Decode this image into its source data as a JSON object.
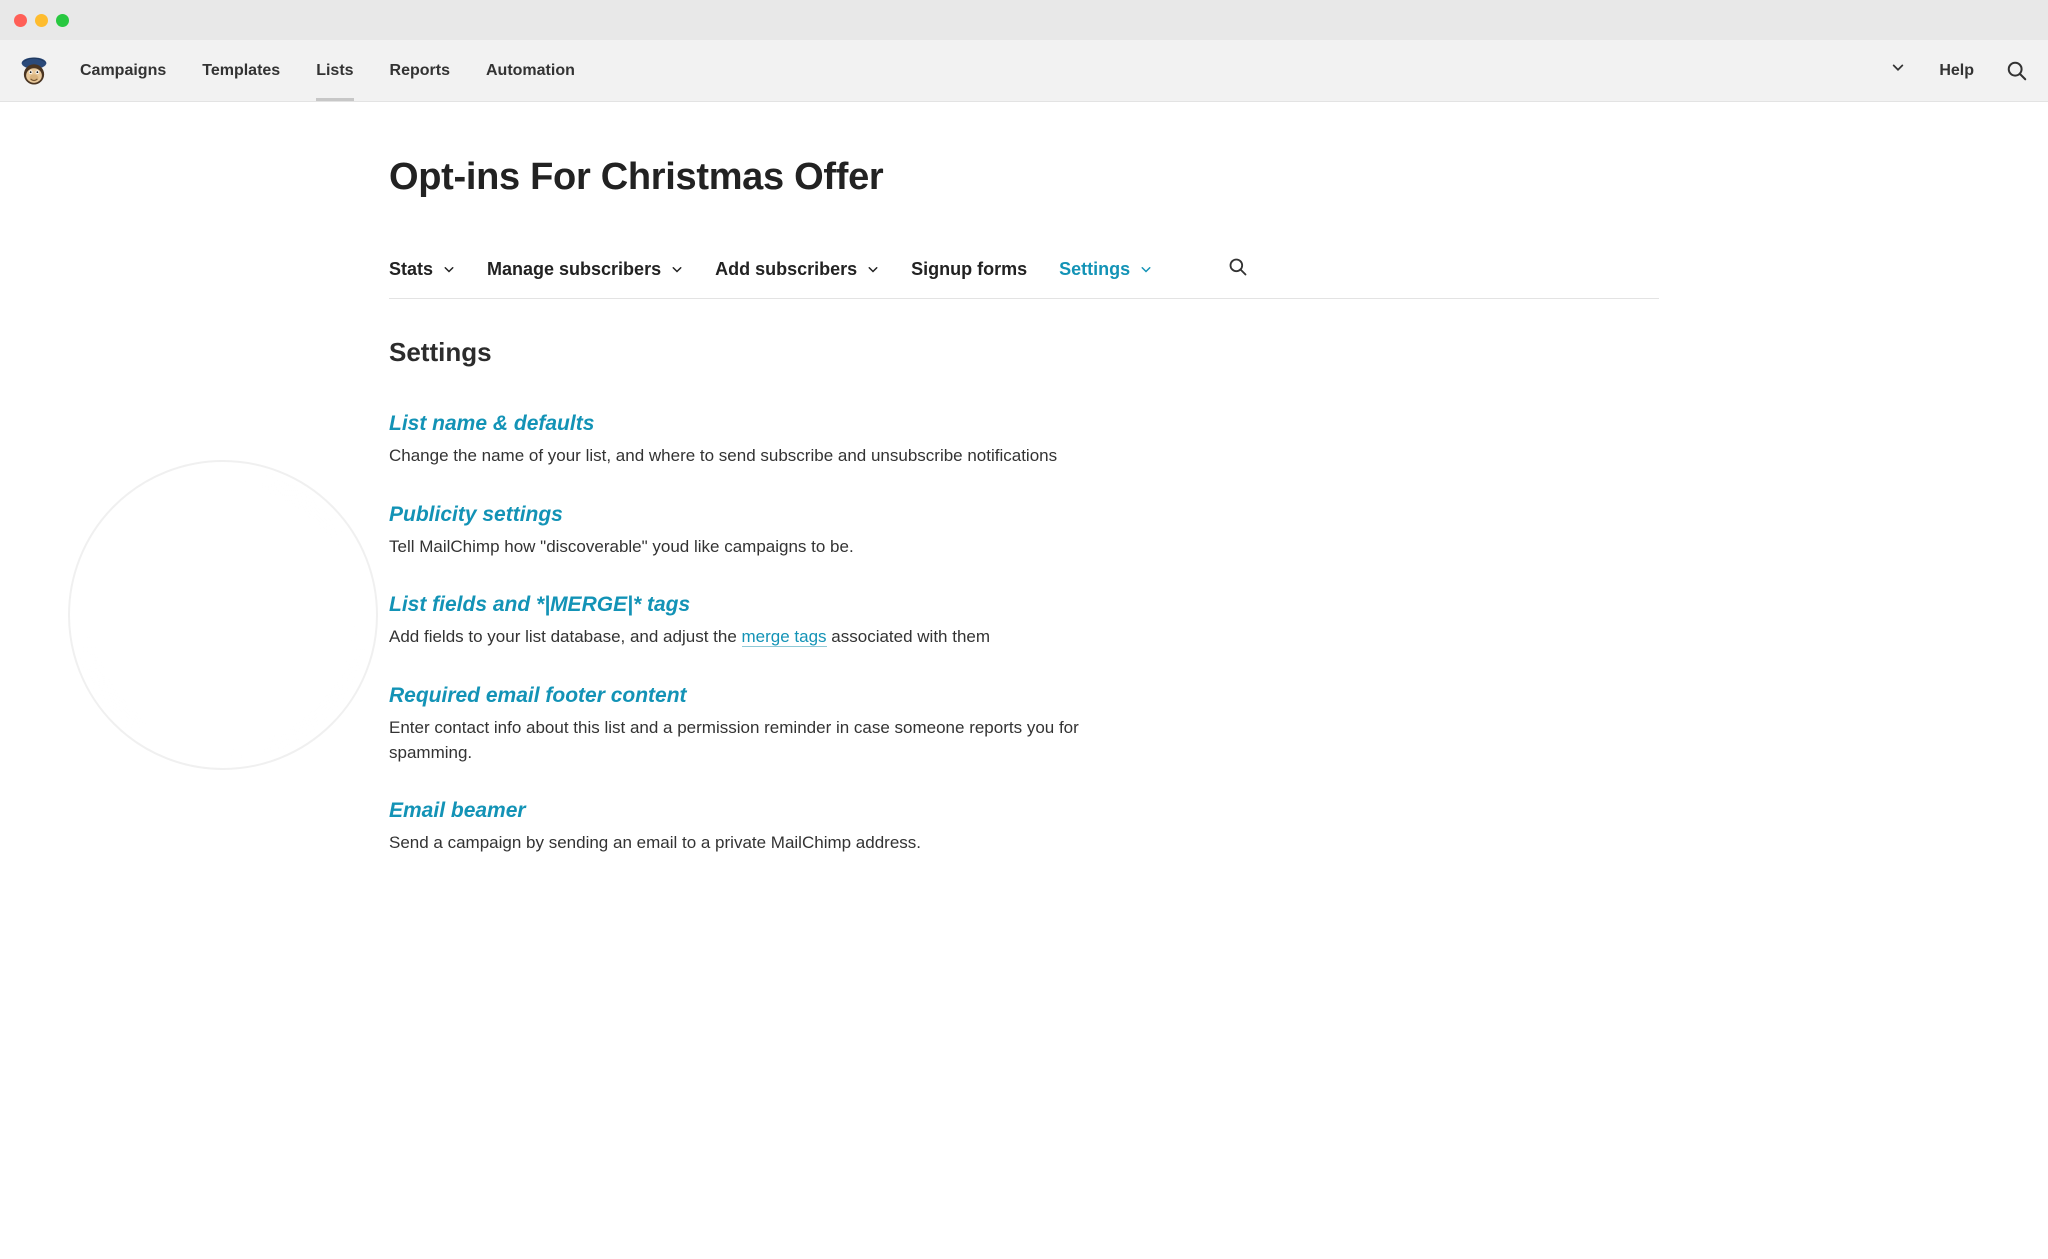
{
  "nav": {
    "items": [
      "Campaigns",
      "Templates",
      "Lists",
      "Reports",
      "Automation"
    ],
    "active_index": 2,
    "help_label": "Help"
  },
  "page": {
    "title": "Opt-ins For Christmas Offer"
  },
  "subtabs": {
    "items": [
      {
        "label": "Stats",
        "has_caret": true
      },
      {
        "label": "Manage subscribers",
        "has_caret": true
      },
      {
        "label": "Add subscribers",
        "has_caret": true
      },
      {
        "label": "Signup forms",
        "has_caret": false
      },
      {
        "label": "Settings",
        "has_caret": true
      }
    ],
    "active_index": 4
  },
  "section_heading": "Settings",
  "settings": [
    {
      "title": "List name & defaults",
      "desc_pre": "Change the name of your list, and where to send subscribe and unsubscribe notifications",
      "link_text": "",
      "desc_post": ""
    },
    {
      "title": "Publicity settings",
      "desc_pre": "Tell MailChimp how \"discoverable\" youd like campaigns to be.",
      "link_text": "",
      "desc_post": ""
    },
    {
      "title": "List fields and *|MERGE|* tags",
      "desc_pre": "Add fields to your list database, and adjust the ",
      "link_text": "merge tags",
      "desc_post": " associated with them"
    },
    {
      "title": "Required email footer content",
      "desc_pre": "Enter contact info about this list and a permission reminder in case someone reports you for spamming.",
      "link_text": "",
      "desc_post": ""
    },
    {
      "title": "Email beamer",
      "desc_pre": "Send a campaign by sending an email to a private MailChimp address.",
      "link_text": "",
      "desc_post": ""
    }
  ]
}
